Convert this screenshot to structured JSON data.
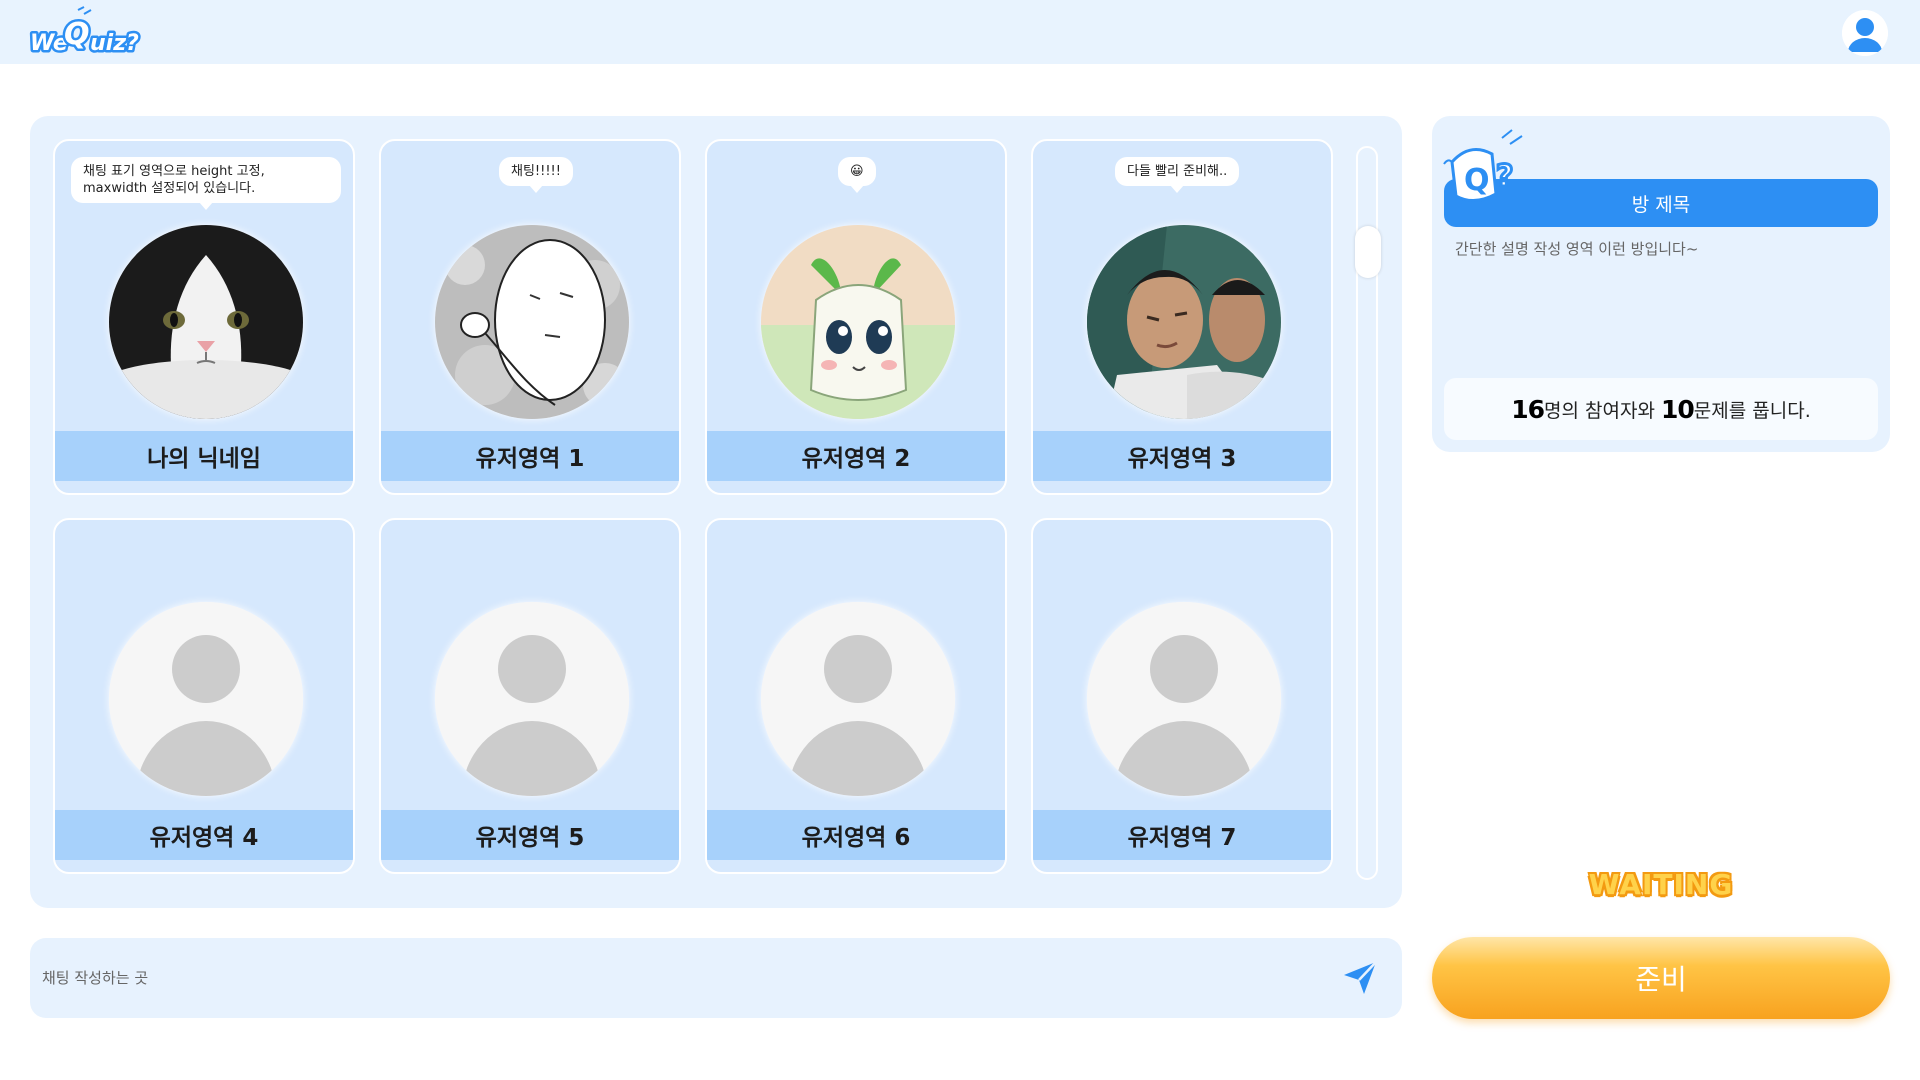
{
  "header": {
    "logo_text": "WeQuiz?"
  },
  "players": [
    {
      "name": "나의 닉네임",
      "chat": "채팅 표기 영역으로 height 고정, maxwidth 설정되어 있습니다.",
      "avatar": "cat-photo"
    },
    {
      "name": "유저영역 1",
      "chat": "채팅!!!!!",
      "avatar": "manga-sketch"
    },
    {
      "name": "유저영역 2",
      "chat": "😀",
      "avatar": "green-sprout-character"
    },
    {
      "name": "유저영역 3",
      "chat": "다들 빨리 준비해..",
      "avatar": "sleeping-man-photo"
    },
    {
      "name": "유저영역 4",
      "chat": "",
      "avatar": "default-user-icon"
    },
    {
      "name": "유저영역 5",
      "chat": "",
      "avatar": "default-user-icon"
    },
    {
      "name": "유저영역 6",
      "chat": "",
      "avatar": "default-user-icon"
    },
    {
      "name": "유저영역 7",
      "chat": "",
      "avatar": "default-user-icon"
    }
  ],
  "room": {
    "title": "방 제목",
    "description": "간단한 설명 작성 영역 이런 방입니다~",
    "participants": "16",
    "participants_suffix": "명의 참여자와 ",
    "questions": "10",
    "questions_suffix": "문제를 풉니다."
  },
  "status": {
    "label": "WAITING"
  },
  "chat": {
    "placeholder": "채팅 작성하는 곳"
  },
  "ready_button": {
    "label": "준비"
  },
  "colors": {
    "primary": "#2d8ff3",
    "panel": "#e7f2fe",
    "card": "#d6e8fd",
    "name_bar": "#a7d1fb",
    "ready": "#f8a21f"
  }
}
